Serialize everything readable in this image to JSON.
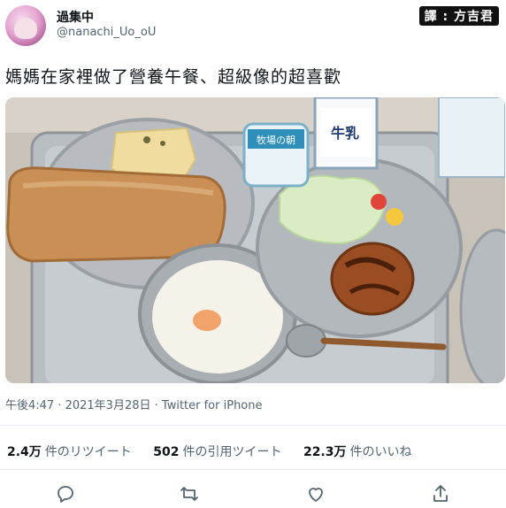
{
  "user": {
    "display_name": "過集中",
    "handle": "@nanachi_Uo_oU"
  },
  "watermark": "譯 : 方吉君",
  "tweet": {
    "text": "媽媽在家裡做了營養午餐、超級像的超喜歡"
  },
  "meta": {
    "timestamp": "午後4:47 · 2021年3月28日",
    "separator": " · ",
    "source": "Twitter for iPhone"
  },
  "stats": [
    {
      "count": "2.4万",
      "label": "件のリツイート"
    },
    {
      "count": "502",
      "label": "件の引用ツイート"
    },
    {
      "count": "22.3万",
      "label": "件のいいね"
    }
  ],
  "photo": {
    "milk_carton_label": "牛乳",
    "cup_label": "牧場の朝"
  },
  "actions": [
    "reply-icon",
    "retweet-icon",
    "like-icon",
    "share-icon"
  ],
  "colors": {
    "text": "#0f1419",
    "secondary": "#536471",
    "divider": "#e6ecf0"
  }
}
